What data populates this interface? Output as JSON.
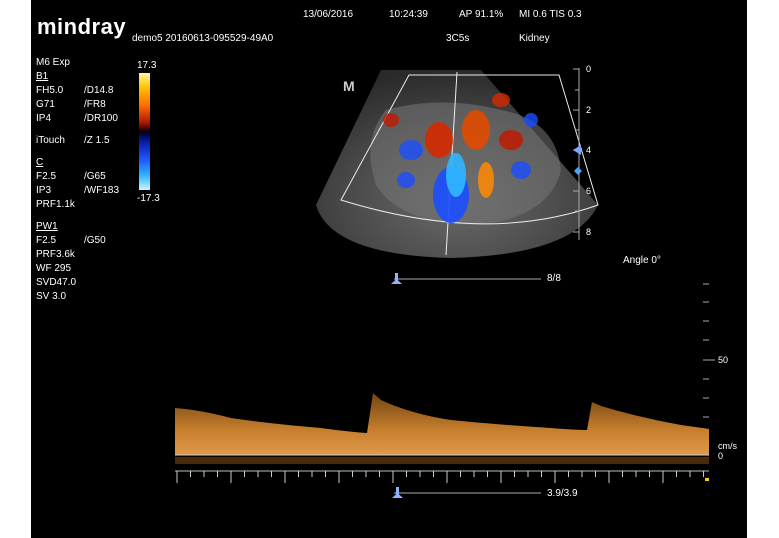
{
  "brand": {
    "logo": "mindray"
  },
  "header": {
    "date": "13/06/2016",
    "time": "10:24:39",
    "ap": "AP 91.1%",
    "mi_tis": "MI 0.6 TIS 0.3",
    "patient_id": "demo5 20160613-095529-49A0",
    "probe": "3C5s",
    "exam": "Kidney"
  },
  "params": {
    "mode": "M6 Exp",
    "b1": {
      "title": "B1",
      "rows": [
        [
          "FH5.0",
          "/D14.8"
        ],
        [
          "G71",
          "/FR8"
        ],
        [
          "IP4",
          "/DR100"
        ],
        [
          "iTouch",
          "/Z 1.5"
        ]
      ]
    },
    "c": {
      "title": "C",
      "rows": [
        [
          "F2.5",
          "/G65"
        ],
        [
          "IP3",
          "/WF183"
        ],
        [
          "PRF1.1k",
          ""
        ]
      ]
    },
    "pw1": {
      "title": "PW1",
      "rows": [
        [
          "F2.5",
          "/G50"
        ],
        [
          "PRF3.6k",
          ""
        ],
        [
          "WF 295",
          ""
        ],
        [
          "SVD47.0",
          ""
        ],
        [
          "SV 3.0",
          ""
        ]
      ]
    }
  },
  "color_scale": {
    "max": "17.3",
    "min": "-17.3"
  },
  "image_area": {
    "marker": "M",
    "depth_labels": [
      "0",
      "2",
      "4",
      "6",
      "8"
    ],
    "frame_counter": "8/8"
  },
  "doppler": {
    "angle": "Angle 0°",
    "velocity_tick": "50",
    "unit": "cm/s",
    "baseline": "0",
    "frame_counter": "3.9/3.9"
  },
  "colors": {
    "background": "#000000",
    "spectrum": "#e0923a",
    "accent_blue": "#7aa7ff"
  }
}
